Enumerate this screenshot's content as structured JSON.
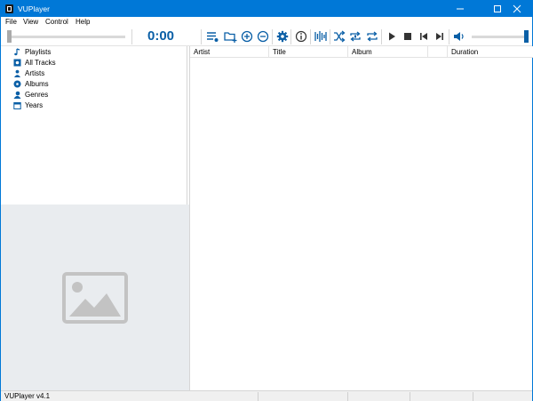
{
  "window": {
    "title": "VUPlayer",
    "accent": "#0078d7"
  },
  "menu": {
    "items": [
      "File",
      "View",
      "Control",
      "Help"
    ]
  },
  "toolbar": {
    "time": "0:00",
    "time_color": "#0a5fa6",
    "icons": [
      "playlist-menu-icon",
      "add-folder-icon",
      "add-icon",
      "remove-icon",
      "settings-icon",
      "info-icon",
      "equalizer-icon",
      "shuffle-icon",
      "repeat-track-icon",
      "repeat-playlist-icon",
      "play-icon",
      "stop-icon",
      "previous-icon",
      "next-icon",
      "volume-icon"
    ]
  },
  "tree": {
    "items": [
      {
        "label": "Playlists",
        "icon": "music-note-icon"
      },
      {
        "label": "All Tracks",
        "icon": "tracks-icon"
      },
      {
        "label": "Artists",
        "icon": "person-icon"
      },
      {
        "label": "Albums",
        "icon": "disc-icon"
      },
      {
        "label": "Genres",
        "icon": "genre-icon"
      },
      {
        "label": "Years",
        "icon": "calendar-icon"
      }
    ]
  },
  "playlist": {
    "columns": [
      "Artist",
      "Title",
      "Album",
      "",
      "Duration"
    ]
  },
  "status": {
    "text": "VUPlayer v4.1"
  }
}
